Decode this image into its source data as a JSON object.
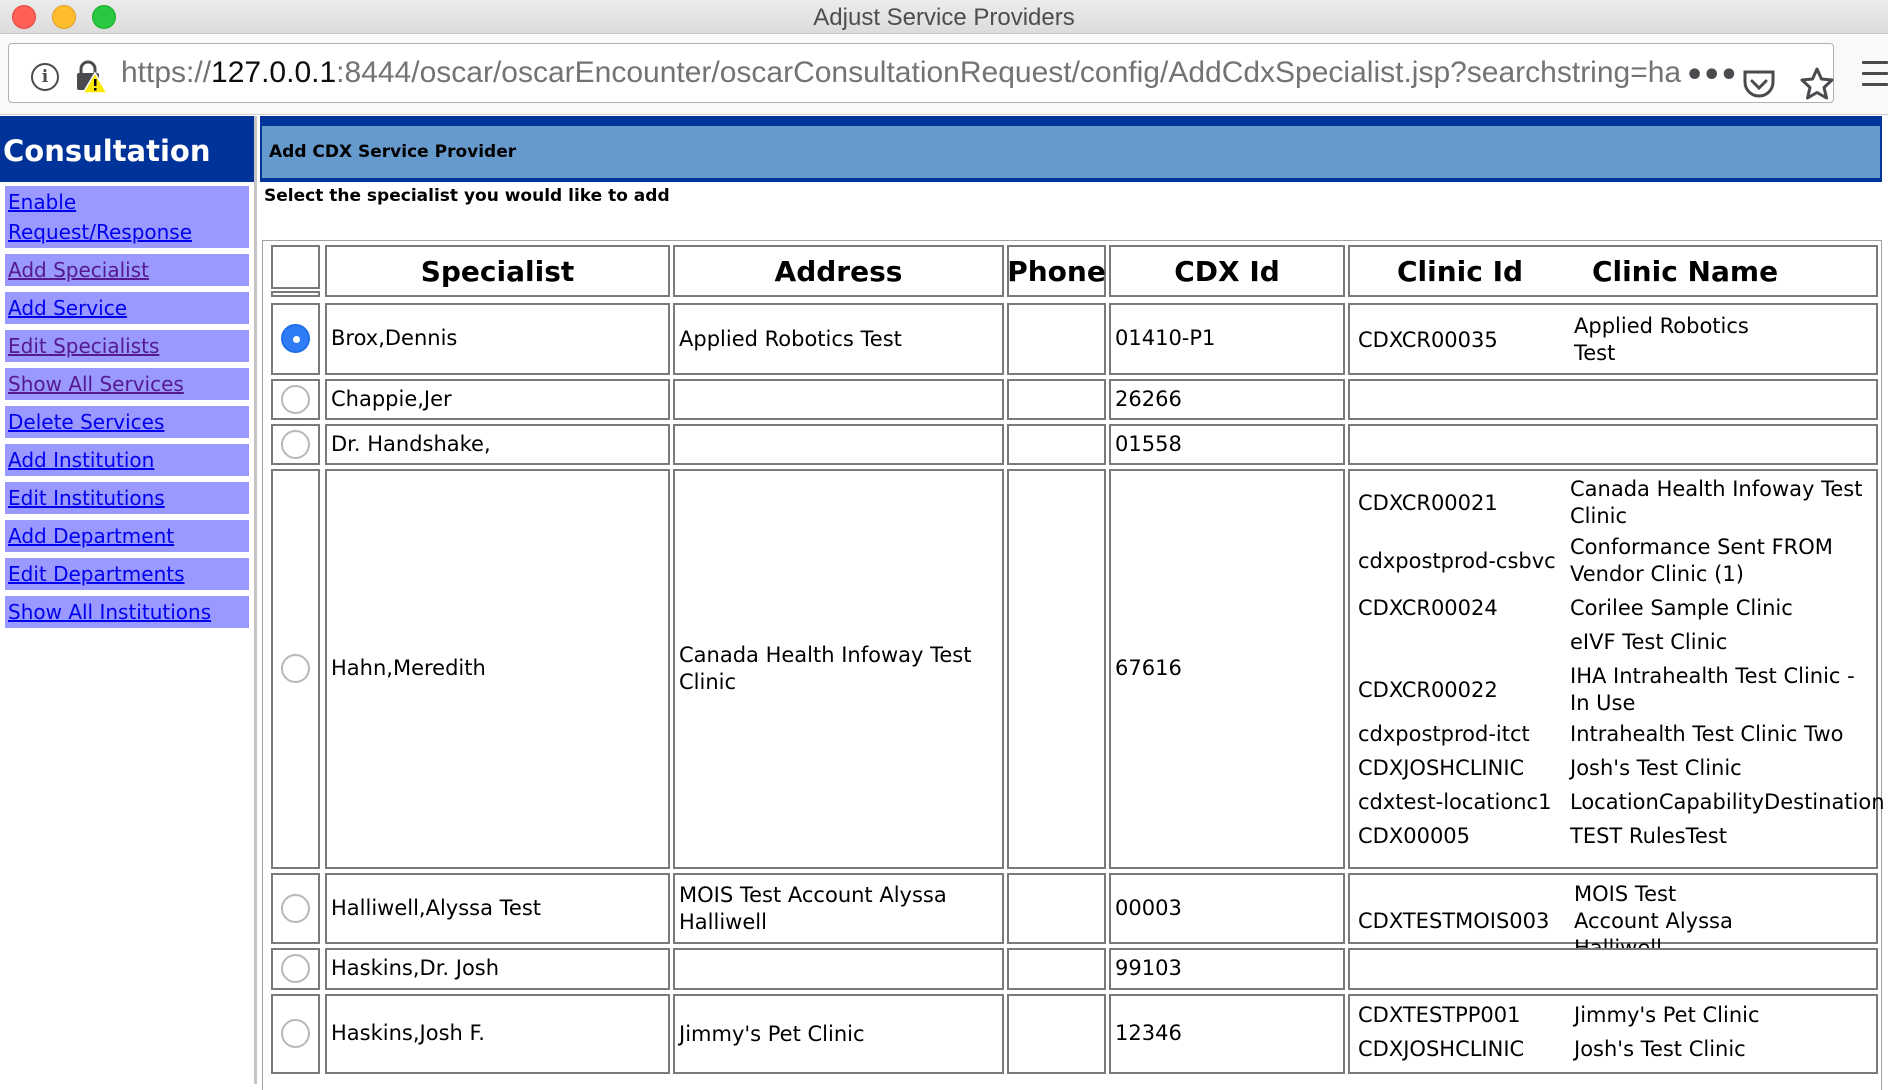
{
  "window": {
    "title": "Adjust Service Providers"
  },
  "browser": {
    "url_prefix": "https://",
    "url_host": "127.0.0.1",
    "url_rest": ":8444/oscar/oscarEncounter/oscarConsultationRequest/config/AddCdxSpecialist.jsp?searchstring=ha",
    "more_glyph": "•••"
  },
  "sidebar": {
    "title": "Consultation",
    "items": [
      {
        "label": "Enable Request/Response",
        "visited": false
      },
      {
        "label": "Add Specialist",
        "visited": true
      },
      {
        "label": "Add Service",
        "visited": false
      },
      {
        "label": "Edit Specialists",
        "visited": true
      },
      {
        "label": "Show All Services",
        "visited": true
      },
      {
        "label": "Delete Services",
        "visited": false
      },
      {
        "label": "Add Institution",
        "visited": false
      },
      {
        "label": "Edit Institutions",
        "visited": false
      },
      {
        "label": "Add Department",
        "visited": false
      },
      {
        "label": "Edit Departments",
        "visited": false
      },
      {
        "label": "Show All Institutions",
        "visited": false
      }
    ]
  },
  "main": {
    "header": "Add CDX Service Provider",
    "instruction": "Select the specialist you would like to add"
  },
  "table": {
    "headers": {
      "specialist": "Specialist",
      "address": "Address",
      "phone": "Phone",
      "cdx_id": "CDX Id",
      "clinic_id": "Clinic Id",
      "clinic_name": "Clinic Name"
    },
    "rows": [
      {
        "selected": true,
        "specialist": "Brox,Dennis",
        "address": "Applied Robotics Test",
        "phone": "",
        "cdx_id": "01410-P1",
        "clinics": [
          {
            "id": "CDXCR00035",
            "name": "Applied Robotics Test"
          }
        ]
      },
      {
        "selected": false,
        "specialist": "Chappie,Jer",
        "address": "",
        "phone": "",
        "cdx_id": "26266",
        "clinics": []
      },
      {
        "selected": false,
        "specialist": "Dr. Handshake,",
        "address": "",
        "phone": "",
        "cdx_id": "01558",
        "clinics": []
      },
      {
        "selected": false,
        "specialist": "Hahn,Meredith",
        "address": "Canada Health Infoway Test Clinic",
        "phone": "",
        "cdx_id": "67616",
        "clinics": [
          {
            "id": "CDXCR00021",
            "name": "Canada Health Infoway Test Clinic"
          },
          {
            "id": "cdxpostprod-csbvc",
            "name": "Conformance Sent FROM Vendor Clinic (1)"
          },
          {
            "id": "CDXCR00024",
            "name": "Corilee Sample Clinic"
          },
          {
            "id": "",
            "name": "eIVF Test Clinic"
          },
          {
            "id": "CDXCR00022",
            "name": "IHA Intrahealth Test Clinic - In Use"
          },
          {
            "id": "cdxpostprod-itct",
            "name": "Intrahealth Test Clinic Two"
          },
          {
            "id": "CDXJOSHCLINIC",
            "name": "Josh's Test Clinic"
          },
          {
            "id": "cdxtest-locationc1",
            "name": "LocationCapabilityDestination"
          },
          {
            "id": "CDX00005",
            "name": "TEST RulesTest"
          }
        ]
      },
      {
        "selected": false,
        "specialist": "Halliwell,Alyssa Test",
        "address": "MOIS Test Account Alyssa Halliwell",
        "phone": "",
        "cdx_id": "00003",
        "clinics": [
          {
            "id": "CDXTESTMOIS003",
            "name": "MOIS Test Account Alyssa Halliwell"
          }
        ]
      },
      {
        "selected": false,
        "specialist": "Haskins,Dr. Josh",
        "address": "",
        "phone": "",
        "cdx_id": "99103",
        "clinics": []
      },
      {
        "selected": false,
        "specialist": "Haskins,Josh F.",
        "address": "Jimmy's Pet Clinic",
        "phone": "",
        "cdx_id": "12346",
        "clinics": [
          {
            "id": "CDXTESTPP001",
            "name": "Jimmy's Pet Clinic"
          },
          {
            "id": "CDXJOSHCLINIC",
            "name": "Josh's Test Clinic"
          }
        ]
      }
    ]
  }
}
